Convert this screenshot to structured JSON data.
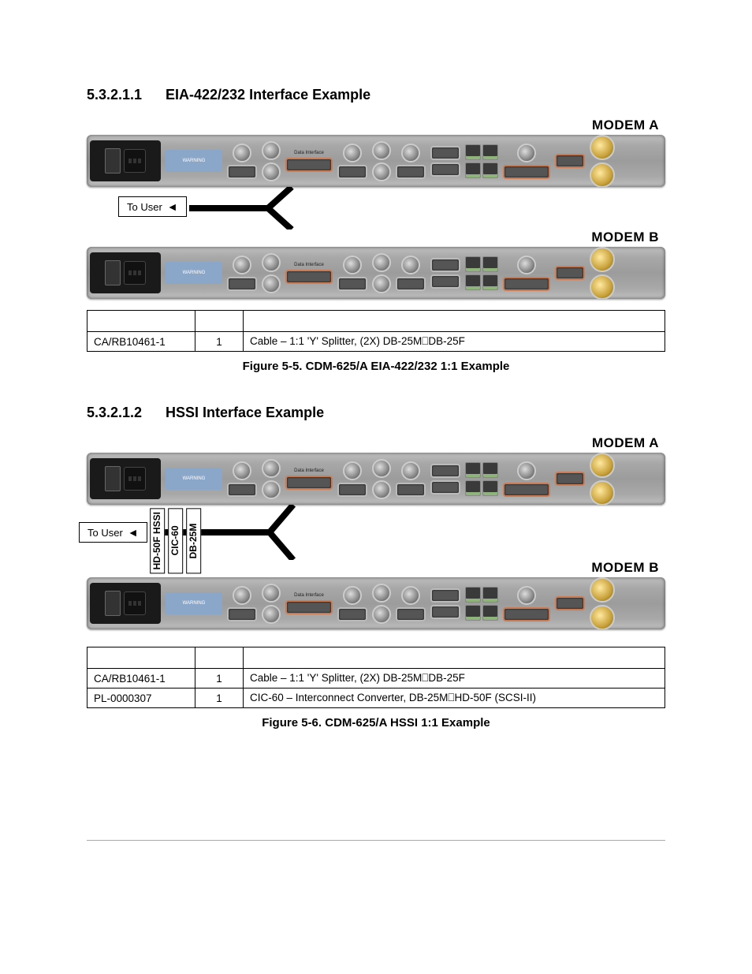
{
  "section1": {
    "number": "5.3.2.1.1",
    "title": "EIA-422/232 Interface Example"
  },
  "section2": {
    "number": "5.3.2.1.2",
    "title": "HSSI Interface Example"
  },
  "labels": {
    "modemA": "MODEM A",
    "modemB": "MODEM B",
    "toUser": "To User",
    "hd50f": "HD-50F HSSI",
    "cic60": "CIC-60",
    "db25m": "DB-25M"
  },
  "table1": {
    "rows": [
      {
        "pn": "CA/RB10461-1",
        "qty": "1",
        "desc": "Cable – 1:1 'Y' Splitter, (2X) DB-25M⎕DB-25F"
      }
    ]
  },
  "table2": {
    "rows": [
      {
        "pn": "CA/RB10461-1",
        "qty": "1",
        "desc": "Cable – 1:1 'Y' Splitter, (2X) DB-25M⎕DB-25F"
      },
      {
        "pn": "PL-0000307",
        "qty": "1",
        "desc": "CIC-60 – Interconnect Converter, DB-25M⎕HD-50F (SCSI-II)"
      }
    ]
  },
  "caption1": "Figure 5-5. CDM-625/A EIA-422/232 1:1 Example",
  "caption2": "Figure 5-6. CDM-625/A HSSI 1:1 Example"
}
